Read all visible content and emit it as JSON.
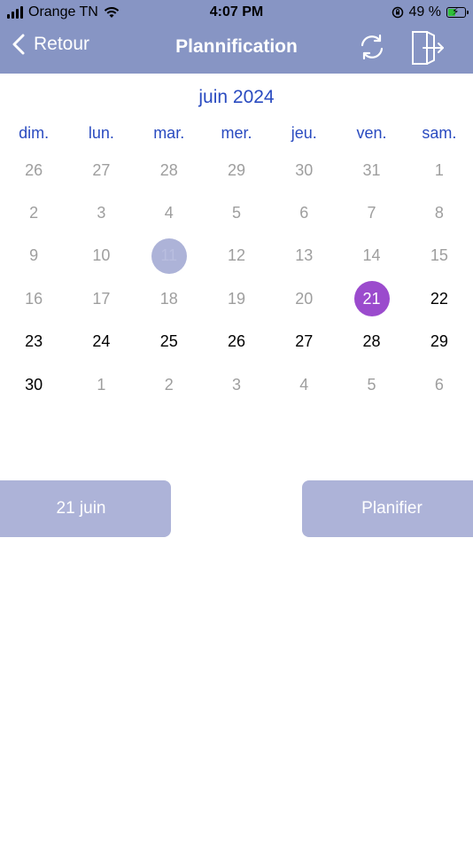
{
  "status": {
    "carrier": "Orange TN",
    "time": "4:07 PM",
    "battery": "49 %",
    "battery_level": 0.49
  },
  "header": {
    "back_label": "Retour",
    "title": "Plannification",
    "icons": [
      "chevron-left-icon",
      "refresh-icon",
      "logout-door-icon"
    ]
  },
  "calendar": {
    "month_label": "juin 2024",
    "weekdays": [
      "dim.",
      "lun.",
      "mar.",
      "mer.",
      "jeu.",
      "ven.",
      "sam."
    ],
    "days": [
      "26",
      "27",
      "28",
      "29",
      "30",
      "31",
      "1",
      "2",
      "3",
      "4",
      "5",
      "6",
      "7",
      "8",
      "9",
      "10",
      "11",
      "12",
      "13",
      "14",
      "15",
      "16",
      "17",
      "18",
      "19",
      "20",
      "21",
      "22",
      "23",
      "24",
      "25",
      "26",
      "27",
      "28",
      "29",
      "30",
      "1",
      "2",
      "3",
      "4",
      "5",
      "6"
    ],
    "today_index": 16,
    "selected_index": 26,
    "active_indices": [
      26,
      27,
      28,
      29,
      30,
      31,
      32,
      33,
      34,
      35
    ],
    "colors": {
      "header": "#8795c4",
      "accent_text": "#2a4bc0",
      "selected": "#9b4bcd",
      "today": "#adb3d8",
      "disabled": "#9e9e9e"
    }
  },
  "actions": {
    "date_button": "21 juin",
    "plan_button": "Planifier"
  }
}
